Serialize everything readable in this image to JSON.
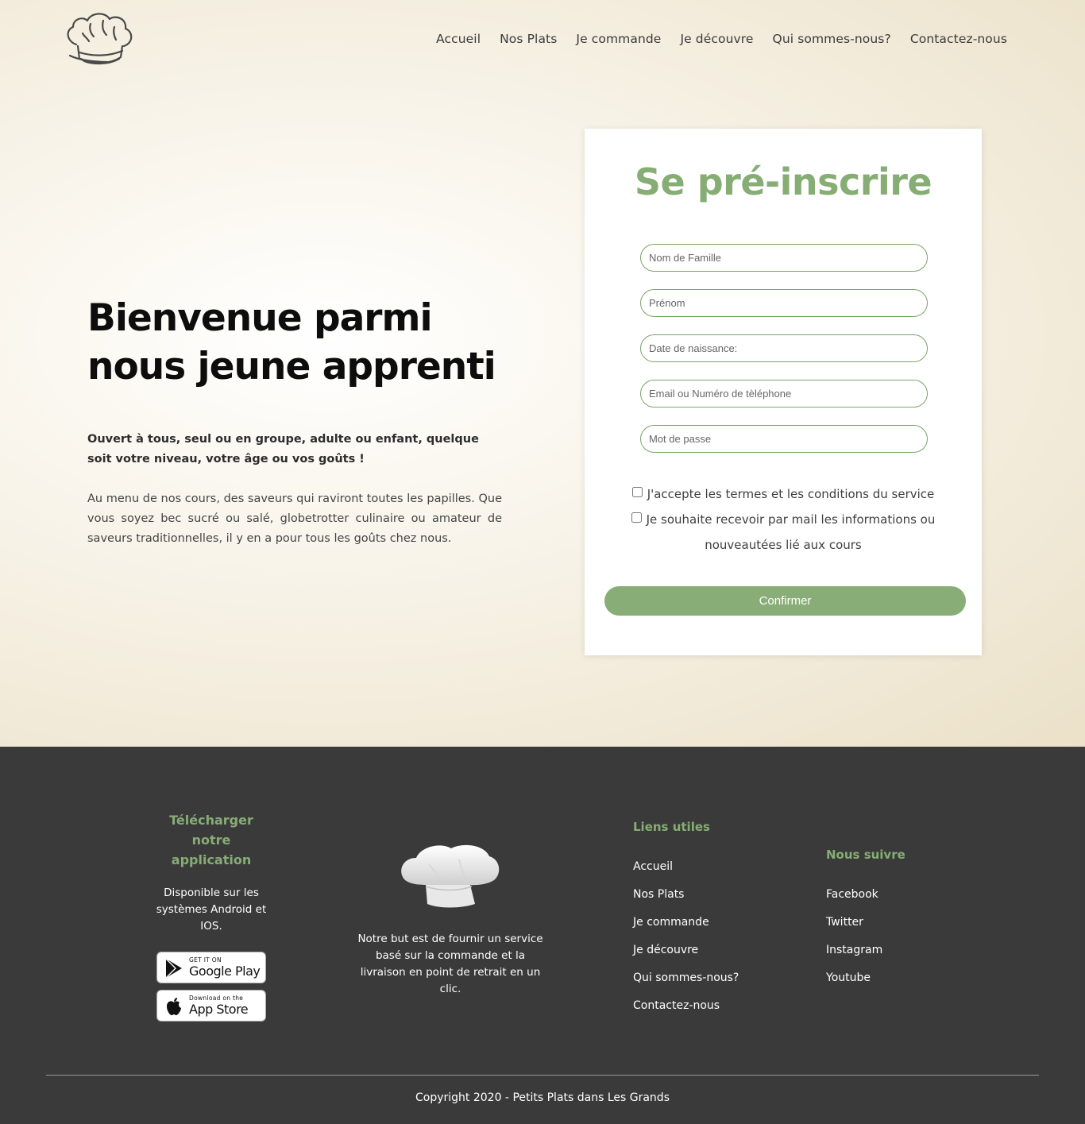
{
  "nav": {
    "items": [
      "Accueil",
      "Nos Plats",
      "Je commande",
      "Je découvre",
      "Qui sommes-nous?",
      "Contactez-nous"
    ]
  },
  "hero": {
    "title": "Bienvenue parmi nous jeune apprenti",
    "lead": "Ouvert à tous, seul ou en groupe, adulte ou enfant, quelque soit votre niveau, votre âge ou vos goûts !",
    "body": "Au menu de nos cours, des saveurs qui raviront toutes les papilles. Que vous soyez bec sucré ou salé, globetrotter culinaire ou amateur de saveurs traditionnelles, il y en a pour tous les goûts chez nous."
  },
  "form": {
    "title": "Se pré-inscrire",
    "fields": {
      "last_name": "Nom de Famille",
      "first_name": "Prénom",
      "birth_date": "Date de naissance:",
      "contact": "Email ou Numéro de tèléphone",
      "password": "Mot de passe"
    },
    "checkbox_terms": "J'accepte les termes et les conditions du service",
    "checkbox_news_line1": "Je souhaite recevoir par mail les informations ou",
    "checkbox_news_line2": "nouveautées lié aux cours",
    "confirm_label": "Confirmer"
  },
  "footer": {
    "app": {
      "title": "Télécharger notre application",
      "text": "Disponible sur les systèmes Android et IOS.",
      "google_small": "GET IT ON",
      "google_big": "Google Play",
      "apple_small": "Download on the",
      "apple_big": "App Store"
    },
    "about": "Notre but est de fournir un service basé sur la commande et la livraison en point de retrait en un clic.",
    "links": {
      "title": "Liens utiles",
      "items": [
        "Accueil",
        "Nos Plats",
        "Je commande",
        "Je découvre",
        "Qui sommes-nous?",
        "Contactez-nous"
      ]
    },
    "social": {
      "title": "Nous suivre",
      "items": [
        "Facebook",
        "Twitter",
        "Instagram",
        "Youtube"
      ]
    },
    "copyright": "Copyright 2020 - Petits Plats dans Les Grands"
  },
  "colors": {
    "accent_green": "#86ad74",
    "footer_bg": "#3a3a3a",
    "hero_bg": "#f3ecdc"
  },
  "icons": [
    "chef-hat-logo-icon",
    "google-play-icon",
    "apple-icon",
    "chef-hat-icon"
  ]
}
